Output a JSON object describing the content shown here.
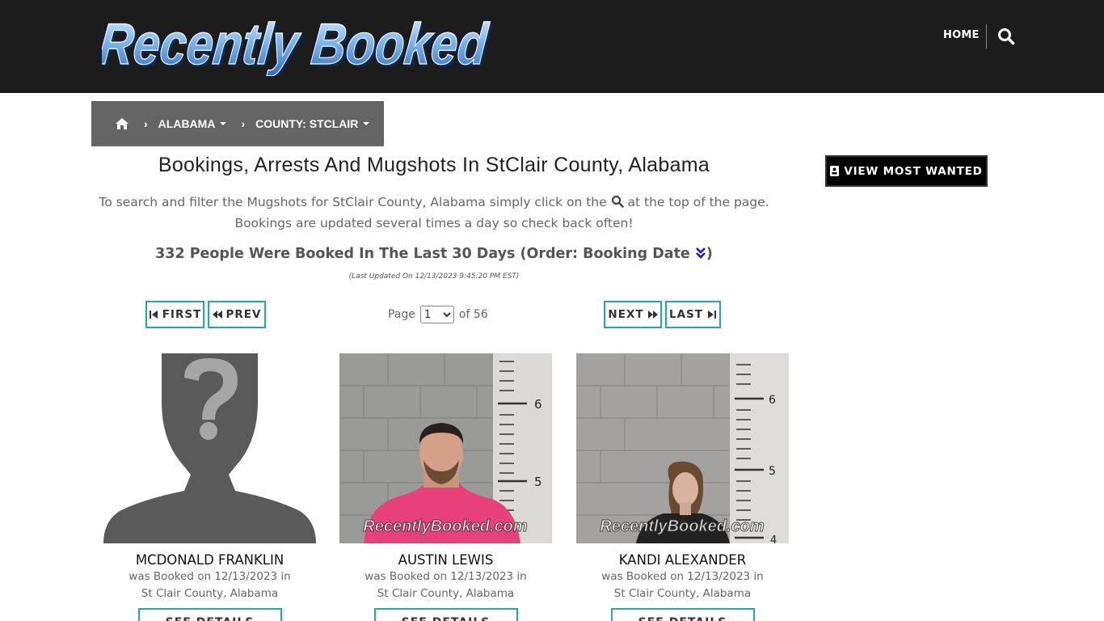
{
  "header": {
    "logo_text": "Recently Booked",
    "nav_home": "HOME"
  },
  "breadcrumb": {
    "state": "ALABAMA",
    "county": "COUNTY: STCLAIR"
  },
  "page": {
    "title": "Bookings, Arrests And Mugshots In StClair County, Alabama",
    "desc_line1_a": "To search and filter the Mugshots for StClair County, Alabama simply click on the",
    "desc_line1_b": "at the top of the page.",
    "desc_line2": "Bookings are updated several times a day so check back often!",
    "count_text": "332 People Were Booked In The Last 30 Days (Order: Booking Date",
    "count_close": ")",
    "updated": "(Last Updated On 12/13/2023 9:45:20 PM EST)"
  },
  "pagination": {
    "first": "FIRST",
    "prev": "PREV",
    "next": "NEXT",
    "last": "LAST",
    "page_label": "Page",
    "current_page": "1",
    "of_label": "of 56"
  },
  "sidebar": {
    "wanted_label": "VIEW MOST WANTED"
  },
  "watermark": "RecentlyBooked.com",
  "people": [
    {
      "name": "MCDONALD FRANKLIN",
      "booked_line1": "was Booked on 12/13/2023 in",
      "booked_line2": "St Clair County, Alabama",
      "details": "SEE DETAILS"
    },
    {
      "name": "AUSTIN LEWIS",
      "booked_line1": "was Booked on 12/13/2023 in",
      "booked_line2": "St Clair County, Alabama",
      "details": "SEE DETAILS"
    },
    {
      "name": "KANDI ALEXANDER",
      "booked_line1": "was Booked on 12/13/2023 in",
      "booked_line2": "St Clair County, Alabama",
      "details": "SEE DETAILS"
    }
  ],
  "height_marks": [
    "6",
    "5",
    "4"
  ],
  "colors": {
    "header_bg": "#1c1c1c",
    "breadcrumb_bg": "#646464",
    "accent_teal": "#23a9a3",
    "order_icon": "#1a1ad6"
  }
}
